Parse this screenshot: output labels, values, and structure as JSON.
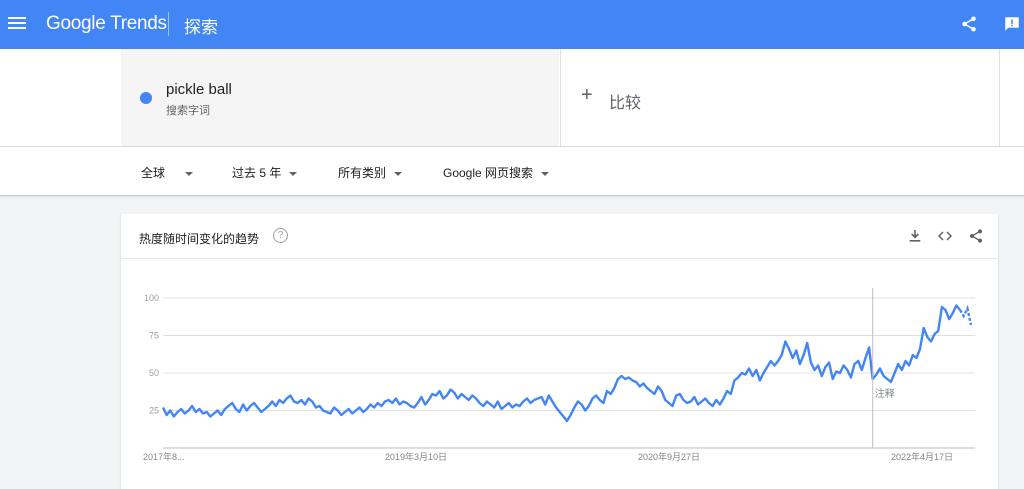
{
  "header": {
    "logo_google": "Google",
    "logo_trends": "Trends",
    "section": "探索"
  },
  "search_term": {
    "name": "pickle ball",
    "subtitle": "搜索字词",
    "color": "#4285f4"
  },
  "compare": {
    "label": "比较"
  },
  "filters": {
    "region": "全球",
    "time": "过去 5 年",
    "category": "所有类别",
    "search_type": "Google 网页搜索"
  },
  "chart_card": {
    "title": "热度随时间变化的趋势",
    "icons": [
      "download-icon",
      "embed-code-icon",
      "share-icon"
    ]
  },
  "chart_data": {
    "type": "line",
    "y_ticks": [
      25,
      50,
      75,
      100
    ],
    "ylim": [
      0,
      100
    ],
    "x_tick_labels": [
      "2017年8...",
      "2019年3月10日",
      "2020年9月27日",
      "2022年4月17日"
    ],
    "annotation": "注释",
    "series": [
      {
        "color": "#4285f4",
        "values": [
          27,
          22,
          25,
          21,
          24,
          26,
          23,
          25,
          28,
          24,
          26,
          23,
          24,
          21,
          23,
          25,
          22,
          26,
          28,
          30,
          26,
          24,
          29,
          25,
          28,
          30,
          27,
          24,
          26,
          28,
          31,
          28,
          32,
          30,
          33,
          35,
          31,
          30,
          32,
          29,
          33,
          31,
          27,
          28,
          25,
          24,
          23,
          27,
          25,
          22,
          24,
          26,
          23,
          25,
          27,
          24,
          26,
          29,
          27,
          30,
          28,
          31,
          32,
          30,
          33,
          29,
          31,
          30,
          28,
          27,
          30,
          34,
          29,
          32,
          36,
          35,
          38,
          33,
          35,
          39,
          37,
          33,
          36,
          34,
          32,
          35,
          33,
          30,
          28,
          31,
          29,
          27,
          31,
          26,
          28,
          30,
          27,
          29,
          28,
          31,
          33,
          30,
          32,
          33,
          34,
          29,
          35,
          31,
          27,
          24,
          21,
          18,
          22,
          27,
          31,
          29,
          25,
          28,
          33,
          35,
          32,
          30,
          38,
          36,
          40,
          46,
          48,
          46,
          47,
          45,
          44,
          41,
          43,
          40,
          38,
          36,
          41,
          38,
          32,
          30,
          28,
          35,
          36,
          32,
          30,
          31,
          34,
          29,
          31,
          33,
          30,
          28,
          32,
          29,
          33,
          38,
          36,
          45,
          47,
          50,
          49,
          53,
          48,
          52,
          45,
          50,
          54,
          58,
          55,
          58,
          62,
          71,
          66,
          60,
          65,
          56,
          62,
          70,
          57,
          52,
          55,
          48,
          54,
          57,
          46,
          51,
          50,
          55,
          52,
          47,
          56,
          58,
          52,
          60,
          67,
          46,
          49,
          53,
          48,
          46,
          44,
          50,
          56,
          52,
          58,
          55,
          62,
          60,
          66,
          80,
          74,
          71,
          76,
          78,
          94,
          92,
          86,
          90,
          95,
          92,
          88,
          93,
          82
        ]
      }
    ]
  }
}
